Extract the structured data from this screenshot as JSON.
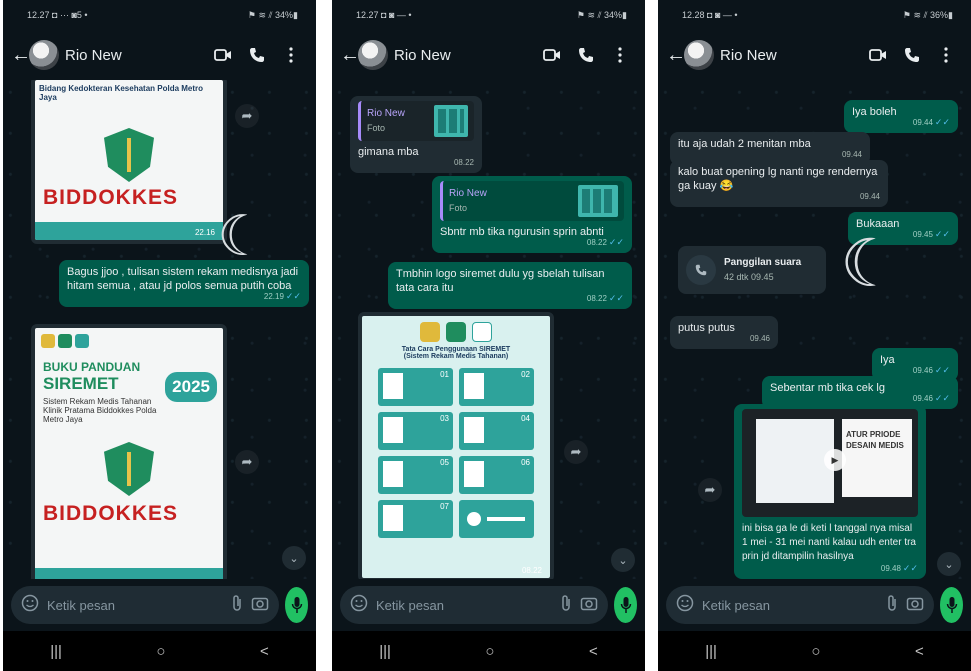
{
  "phones": [
    {
      "status": {
        "time": "12.27",
        "extra": "◘ ··· ◙5 •",
        "right": "⚑ ≋ ⫽ 34%▮"
      },
      "contact": "Rio New",
      "poster1": {
        "top": "Bidang Kedokteran Kesehatan Polda Metro Jaya",
        "brand": "BIDDOKKES",
        "time": "22.16"
      },
      "msg1": {
        "text": "Bagus jjoo , tulisan sistem rekam medisnya jadi hitam semua , atau jd polos semua putih coba",
        "time": "22.19"
      },
      "poster2": {
        "badge": "2025",
        "title1": "BUKU PANDUAN",
        "title2": "SIREMET",
        "sub": "Sistem Rekam Medis Tahanan Klinik Pratama Biddokkes Polda Metro Jaya",
        "brand": "BIDDOKKES"
      },
      "input_placeholder": "Ketik pesan"
    },
    {
      "status": {
        "time": "12.27",
        "extra": "◘ ◙ — •",
        "right": "⚑ ≋ ⫽ 34%▮"
      },
      "contact": "Rio New",
      "msg1": {
        "quote_name": "Rio New",
        "quote_sub": "Foto",
        "text": "gimana mba",
        "time": "08.22"
      },
      "msg2": {
        "quote_name": "Rio New",
        "quote_sub": "Foto",
        "text": "Sbntr mb tika ngurusin sprin abnti",
        "time": "08.22"
      },
      "msg3": {
        "text": "Tmbhin logo siremet dulu yg sbelah tulisan tata cara itu",
        "time": "08.22"
      },
      "poster": {
        "header": "Tata Cara Penggunaan SIREMET (Sistem Rekam Medis Tahanan)",
        "steps": [
          "01",
          "02",
          "03",
          "04",
          "05",
          "06",
          "07"
        ],
        "time": "08.22"
      },
      "input_placeholder": "Ketik pesan"
    },
    {
      "status": {
        "time": "12.28",
        "extra": "◘ ◙ — •",
        "right": "⚑ ≋ ⫽ 36%▮"
      },
      "contact": "Rio New",
      "msg1": {
        "text": "Iya boleh",
        "time": "09.44"
      },
      "msg2": {
        "text": "itu aja udah 2 menitan mba",
        "time": "09.44"
      },
      "msg3": {
        "text": "kalo buat opening lg nanti nge rendernya ga kuay 😂",
        "time": "09.44"
      },
      "msg4": {
        "text": "Bukaaan",
        "time": "09.45"
      },
      "call": {
        "title": "Panggilan suara",
        "duration": "42 dtk",
        "time": "09.45"
      },
      "msg5": {
        "text": "putus putus",
        "time": "09.46"
      },
      "msg6": {
        "text": "Iya",
        "time": "09.46"
      },
      "msg7": {
        "text": "Sebentar mb tika cek lg",
        "time": "09.46"
      },
      "video": {
        "panel": "ATUR PRIODE DESAIN MEDIS",
        "caption": "ini bisa ga le di keti l tanggal nya misal 1 mei - 31 mei nanti kalau udh enter tra prin jd ditampilin hasilnya",
        "time": "09.48"
      },
      "input_placeholder": "Ketik pesan"
    }
  ],
  "navbar": {
    "recents": "|||",
    "home": "○",
    "back": "<"
  },
  "colors": {
    "bg": "#0b141a",
    "incoming": "#202c33",
    "outgoing": "#005c4b",
    "accent": "#21c063",
    "read_tick": "#53bdeb"
  },
  "icons": [
    "back-arrow-icon",
    "video-call-icon",
    "phone-icon",
    "more-options-icon",
    "emoji-icon",
    "attach-icon",
    "camera-icon",
    "mic-icon",
    "forward-icon",
    "chevron-down-icon",
    "voice-call-icon",
    "play-icon"
  ]
}
